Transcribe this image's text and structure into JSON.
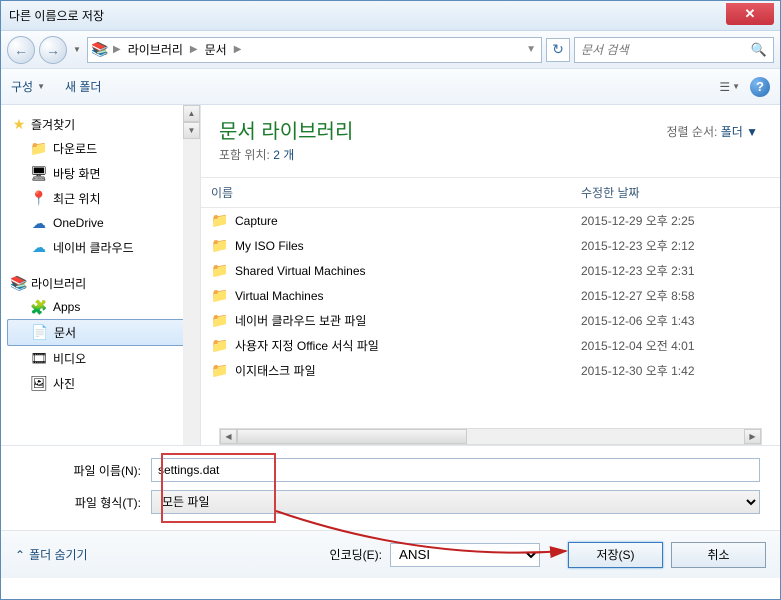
{
  "title": "다른 이름으로 저장",
  "breadcrumb": {
    "root": "라이브러리",
    "current": "문서"
  },
  "search_placeholder": "문서 검색",
  "toolbar": {
    "organize": "구성",
    "organize_dd": "▼",
    "new_folder": "새 폴더"
  },
  "sidebar": {
    "favorites": {
      "label": "즐겨찾기",
      "items": [
        "다운로드",
        "바탕 화면",
        "최근 위치",
        "OneDrive",
        "네이버 클라우드"
      ]
    },
    "libraries": {
      "label": "라이브러리",
      "items": [
        "Apps",
        "문서",
        "비디오",
        "사진"
      ]
    }
  },
  "library": {
    "title": "문서 라이브러리",
    "subtitle_prefix": "포함 위치:",
    "count": "2 개",
    "sort_label": "정렬 순서:",
    "sort_value": "폴더"
  },
  "columns": {
    "name": "이름",
    "date": "수정한 날짜"
  },
  "files": [
    {
      "name": "Capture",
      "date": "2015-12-29 오후 2:25"
    },
    {
      "name": "My ISO Files",
      "date": "2015-12-23 오후 2:12"
    },
    {
      "name": "Shared Virtual Machines",
      "date": "2015-12-23 오후 2:31"
    },
    {
      "name": "Virtual Machines",
      "date": "2015-12-27 오후 8:58"
    },
    {
      "name": "네이버 클라우드 보관 파일",
      "date": "2015-12-06 오후 1:43"
    },
    {
      "name": "사용자 지정 Office 서식 파일",
      "date": "2015-12-04 오전 4:01"
    },
    {
      "name": "이지태스크 파일",
      "date": "2015-12-30 오후 1:42"
    }
  ],
  "fields": {
    "filename_label": "파일 이름(N):",
    "filename_value": "settings.dat",
    "filetype_label": "파일 형식(T):",
    "filetype_value": "모든 파일"
  },
  "footer": {
    "hide_folders": "폴더 숨기기",
    "encoding_label": "인코딩(E):",
    "encoding_value": "ANSI",
    "save": "저장(S)",
    "cancel": "취소"
  }
}
